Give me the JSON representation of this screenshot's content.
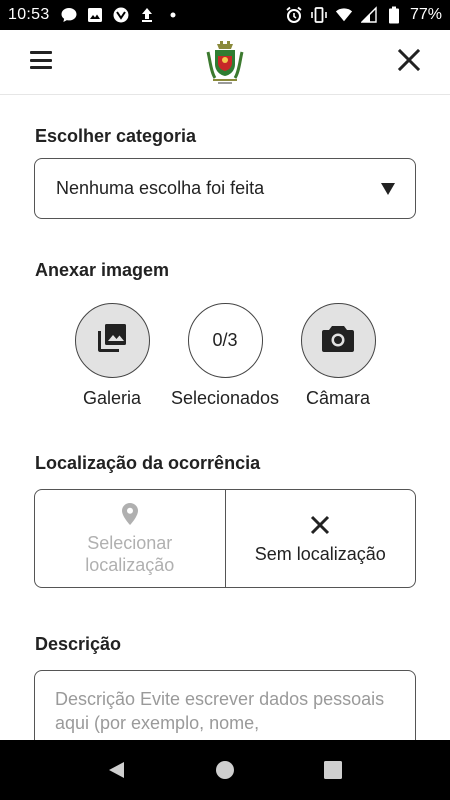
{
  "status_bar": {
    "time": "10:53",
    "battery": "77%",
    "left_icons": [
      "chat-bubble-icon",
      "image-icon",
      "vpn-icon",
      "upload-icon",
      "dot-icon"
    ],
    "right_icons": [
      "alarm-icon",
      "vibrate-icon",
      "wifi-icon",
      "signal-icon",
      "battery-icon"
    ]
  },
  "header": {
    "menu_icon": "hamburger-menu-icon",
    "logo": "municipal-coat-of-arms",
    "close_icon": "close-icon"
  },
  "category": {
    "label": "Escolher categoria",
    "selected": "Nenhuma escolha foi feita"
  },
  "image": {
    "label": "Anexar imagem",
    "gallery_label": "Galeria",
    "counter": "0/3",
    "selected_label": "Selecionados",
    "camera_label": "Câmara"
  },
  "location": {
    "label": "Localização da ocorrência",
    "select_line1": "Selecionar",
    "select_line2": "localização",
    "none_label": "Sem localização"
  },
  "description": {
    "label": "Descrição",
    "placeholder": "Descrição Evite escrever dados pessoais aqui (por exemplo, nome,"
  },
  "colors": {
    "accent_fill": "#e2e2e2",
    "border": "#555555",
    "disabled_text": "#b0b0b0"
  }
}
